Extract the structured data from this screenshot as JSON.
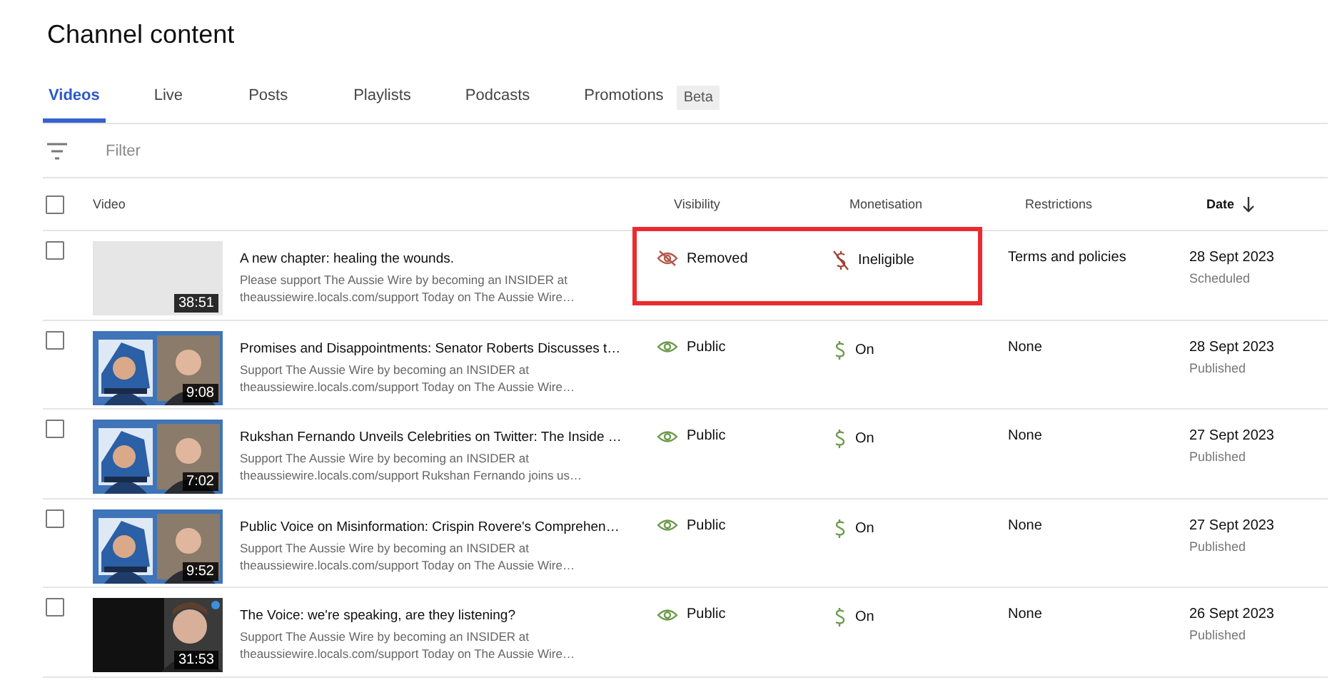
{
  "page": {
    "title": "Channel content"
  },
  "tabs": [
    {
      "label": "Videos",
      "selected": true
    },
    {
      "label": "Live",
      "selected": false
    },
    {
      "label": "Posts",
      "selected": false
    },
    {
      "label": "Playlists",
      "selected": false
    },
    {
      "label": "Podcasts",
      "selected": false
    },
    {
      "label": "Promotions",
      "selected": false,
      "badge": "Beta"
    }
  ],
  "filter": {
    "placeholder": "Filter"
  },
  "table": {
    "select_all_checked": false,
    "columns": [
      "Video",
      "Visibility",
      "Monetisation",
      "Restrictions",
      "Date"
    ],
    "rows": [
      {
        "checked": false,
        "thumbnail_shown": false,
        "duration": "38:51",
        "title": "A new chapter: healing the wounds.",
        "description_1": "Please support The Aussie Wire by becoming an INSIDER at",
        "description_2": "theaussiewire.locals.com/support Today on The Aussie Wire…",
        "visibility": {
          "kind": "removed",
          "label": "Removed"
        },
        "monetisation": {
          "kind": "ineligible",
          "label": "Ineligible"
        },
        "restrictions": "Terms and policies",
        "date": "28 Sept 2023",
        "status": "Scheduled",
        "highlighted": true
      },
      {
        "checked": false,
        "thumbnail_shown": true,
        "duration": "9:08",
        "title": "Promises and Disappointments: Senator Roberts Discusses t…",
        "description_1": "Support The Aussie Wire by becoming an INSIDER at",
        "description_2": "theaussiewire.locals.com/support Today on The Aussie Wire…",
        "visibility": {
          "kind": "public",
          "label": "Public"
        },
        "monetisation": {
          "kind": "on",
          "label": "On"
        },
        "restrictions": "None",
        "date": "28 Sept 2023",
        "status": "Published",
        "highlighted": false
      },
      {
        "checked": false,
        "thumbnail_shown": true,
        "duration": "7:02",
        "title": "Rukshan Fernando Unveils Celebrities on Twitter: The Inside …",
        "description_1": "Support The Aussie Wire by becoming an INSIDER at",
        "description_2": "theaussiewire.locals.com/support Rukshan Fernando joins us…",
        "visibility": {
          "kind": "public",
          "label": "Public"
        },
        "monetisation": {
          "kind": "on",
          "label": "On"
        },
        "restrictions": "None",
        "date": "27 Sept 2023",
        "status": "Published",
        "highlighted": false
      },
      {
        "checked": false,
        "thumbnail_shown": true,
        "duration": "9:52",
        "title": "Public Voice on Misinformation: Crispin Rovere's Comprehen…",
        "description_1": "Support The Aussie Wire by becoming an INSIDER at",
        "description_2": "theaussiewire.locals.com/support Today on The Aussie Wire…",
        "visibility": {
          "kind": "public",
          "label": "Public"
        },
        "monetisation": {
          "kind": "on",
          "label": "On"
        },
        "restrictions": "None",
        "date": "27 Sept 2023",
        "status": "Published",
        "highlighted": false
      },
      {
        "checked": false,
        "thumbnail_shown": true,
        "duration": "31:53",
        "title": "The Voice: we're speaking, are they listening?",
        "description_1": "Support The Aussie Wire by becoming an INSIDER at",
        "description_2": "theaussiewire.locals.com/support Today on The Aussie Wire…",
        "visibility": {
          "kind": "public",
          "label": "Public"
        },
        "monetisation": {
          "kind": "on",
          "label": "On"
        },
        "restrictions": "None",
        "date": "26 Sept 2023",
        "status": "Published",
        "highlighted": false
      }
    ]
  }
}
